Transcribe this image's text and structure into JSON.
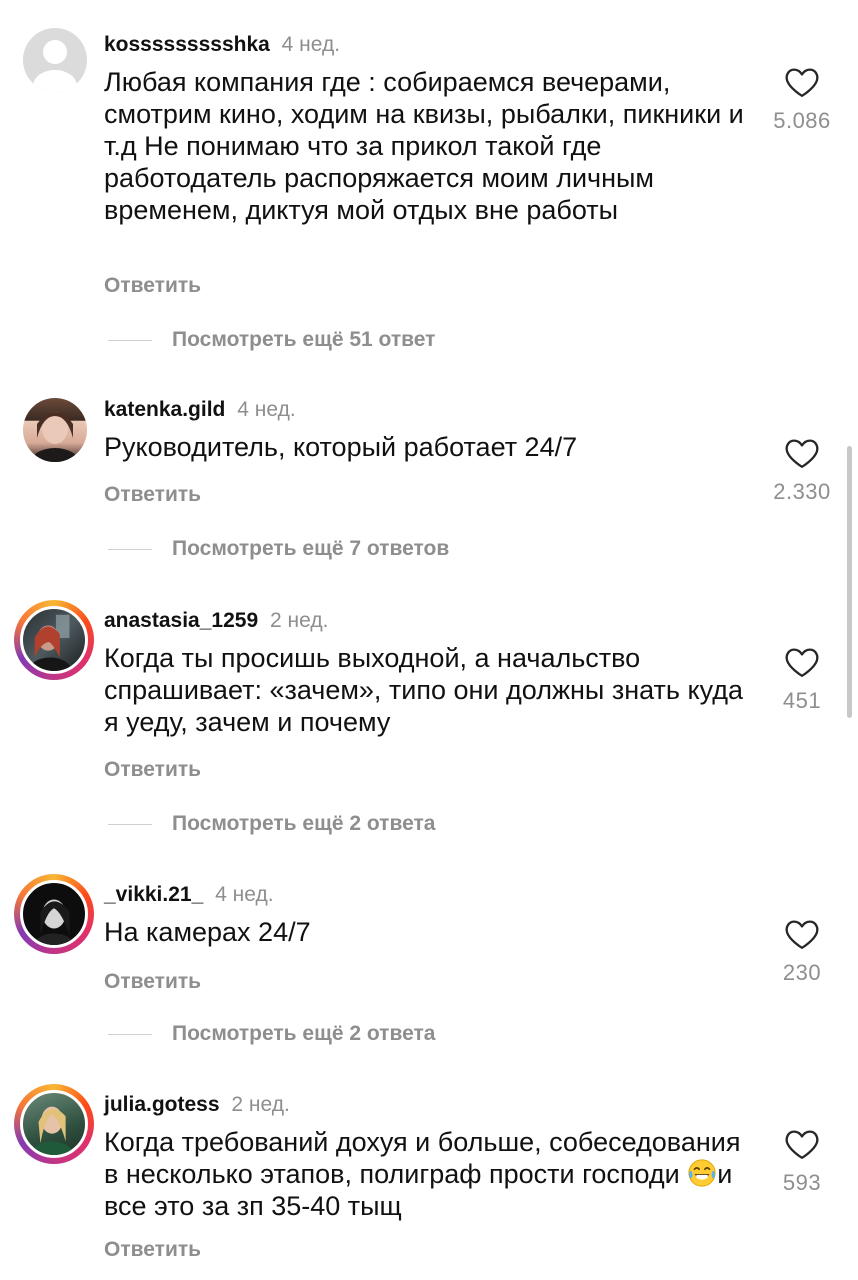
{
  "comments": [
    {
      "username": "kossssssssshka",
      "time": "4 нед.",
      "text": "Любая компания где : собираемся вечерами, смотрим кино, ходим на квизы, рыбалки, пикники и т.д Не понимаю что за прикол такой где работодатель распоряжается моим личным временем, диктуя мой отдых вне работы",
      "reply": "Ответить",
      "more": "Посмотреть ещё 51 ответ",
      "likes": "5.086",
      "avatar": "default-person-icon"
    },
    {
      "username": "katenka.gild",
      "time": "4 нед.",
      "text": "Руководитель, который работает 24/7",
      "reply": "Ответить",
      "more": "Посмотреть ещё 7 ответов",
      "likes": "2.330",
      "avatar": "user-photo"
    },
    {
      "username": "anastasia_1259",
      "time": "2 нед.",
      "text": "Когда ты просишь выходной, а начальство спрашивает: «зачем», типо они должны знать куда я уеду, зачем и почему",
      "reply": "Ответить",
      "more": "Посмотреть ещё 2 ответа",
      "likes": "451",
      "avatar": "user-photo"
    },
    {
      "username": "_vikki.21_",
      "time": "4 нед.",
      "text": "На камерах 24/7",
      "reply": "Ответить",
      "more": "Посмотреть ещё 2 ответа",
      "likes": "230",
      "avatar": "user-photo"
    },
    {
      "username": "julia.gotess",
      "time": "2 нед.",
      "text_before_emoji": "Когда требований дохуя и больше, собеседования в несколько этапов, полиграф прости господи ",
      "emoji": "😂",
      "text_after_emoji": "и все это за зп 35-40 тыщ",
      "reply": "Ответить",
      "likes": "593",
      "avatar": "user-photo"
    }
  ],
  "colors": {
    "secondary_text": "#8e8e8e",
    "story_ring": "#e1306c",
    "divider": "#d0d0d0"
  }
}
